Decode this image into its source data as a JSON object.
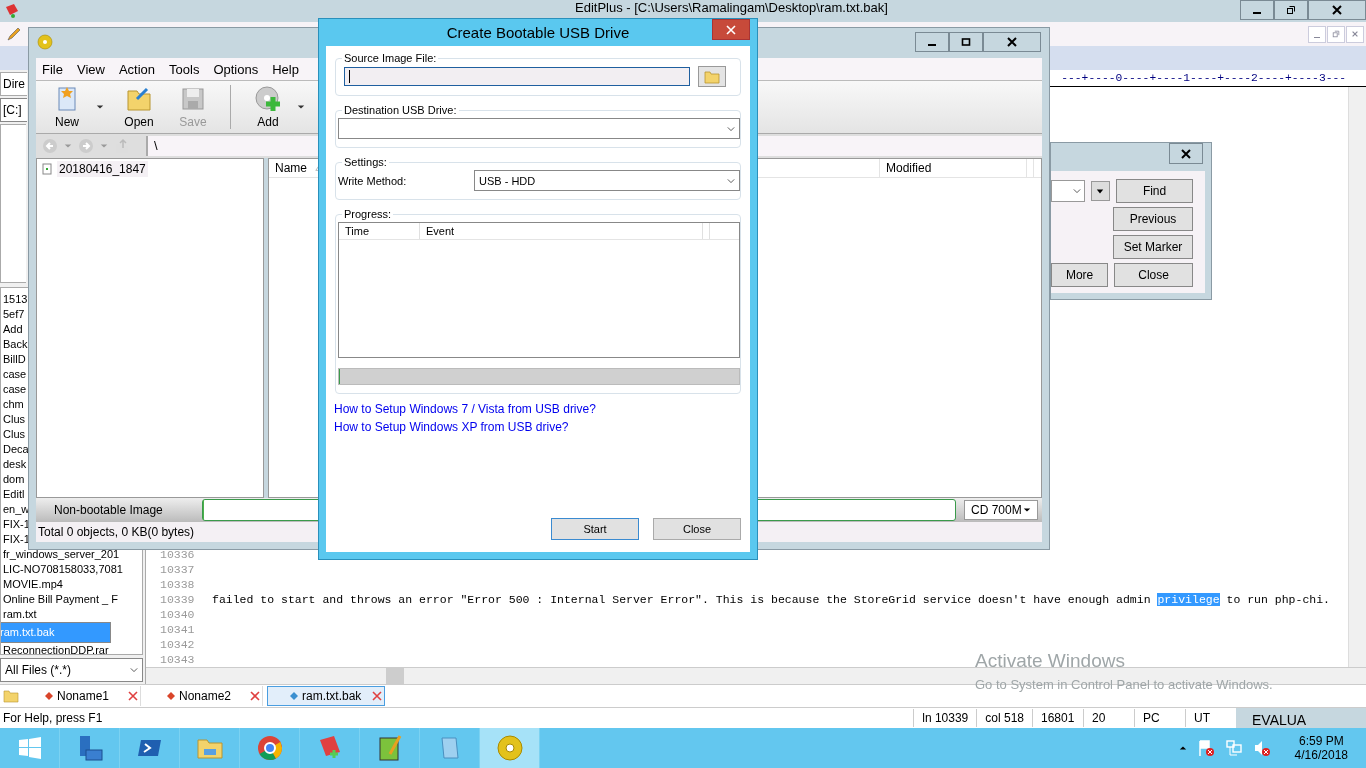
{
  "editplus": {
    "title": "EditPlus - [C:\\Users\\Ramalingam\\Desktop\\ram.txt.bak]",
    "left_panel": {
      "tab": "Dire",
      "drive": "[C:]",
      "files": [
        {
          "name": "1513",
          "selected": false
        },
        {
          "name": "5ef7",
          "selected": false
        },
        {
          "name": "Add",
          "selected": false
        },
        {
          "name": "Back",
          "selected": false
        },
        {
          "name": "BillD",
          "selected": false
        },
        {
          "name": "case",
          "selected": false
        },
        {
          "name": "case",
          "selected": false
        },
        {
          "name": "chm",
          "selected": false
        },
        {
          "name": "Clus",
          "selected": false
        },
        {
          "name": "Clus",
          "selected": false
        },
        {
          "name": "Deca",
          "selected": false
        },
        {
          "name": "desk",
          "selected": false
        },
        {
          "name": "dom",
          "selected": false
        },
        {
          "name": "Editl",
          "selected": false
        },
        {
          "name": "en_w",
          "selected": false
        },
        {
          "name": "FIX-1",
          "selected": false
        },
        {
          "name": "FIX-1",
          "selected": false
        },
        {
          "name": "fr_windows_server_201",
          "selected": false
        },
        {
          "name": "LIC-NO708158033,7081",
          "selected": false
        },
        {
          "name": "MOVIE.mp4",
          "selected": false
        },
        {
          "name": "Online Bill Payment _ F",
          "selected": false
        },
        {
          "name": "ram.txt",
          "selected": false
        },
        {
          "name": "ram.txt.bak",
          "selected": true
        },
        {
          "name": "ReconnectionDDP.rar",
          "selected": false
        }
      ],
      "filter": "All Files (*.*)"
    },
    "ruler": "---+----0----+----1----+----2----+----3---",
    "lines": [
      {
        "number": "10336"
      },
      {
        "number": "10337"
      },
      {
        "number": "10338"
      },
      {
        "number": "10339",
        "segments": [
          {
            "text": "failed to start and throws an error \"Error 500 : Internal Server Error\". This is because the StoreGrid service doesn't have enough admin ",
            "selected": false
          },
          {
            "text": "privilege",
            "selected": true
          },
          {
            "text": " to run php-chi.",
            "selected": false
          }
        ]
      },
      {
        "number": "10340"
      },
      {
        "number": "10341"
      },
      {
        "number": "10342"
      },
      {
        "number": "10343"
      }
    ],
    "doc_tabs": [
      {
        "label": "Noname1",
        "selected": false
      },
      {
        "label": "Noname2",
        "selected": false
      },
      {
        "label": "ram.txt.bak",
        "selected": true
      }
    ],
    "find_dialog": {
      "buttons": [
        "Find",
        "Previous",
        "Set Marker",
        "More",
        "Close"
      ]
    },
    "status_bar": {
      "help": "For Help, press F1",
      "fields": [
        "ln 10339",
        "col 518",
        "16801",
        "20",
        "PC",
        "UT"
      ],
      "edition": "EVALUA"
    }
  },
  "iso_window": {
    "menu": [
      "File",
      "View",
      "Action",
      "Tools",
      "Options",
      "Help"
    ],
    "toolbar": [
      {
        "label": "New",
        "kind": "new",
        "disabled": false,
        "dropdown": true
      },
      {
        "label": "Open",
        "kind": "open",
        "disabled": false,
        "dropdown": false
      },
      {
        "label": "Save",
        "kind": "save",
        "disabled": true,
        "dropdown": false
      },
      {
        "label": "Add",
        "kind": "add",
        "disabled": false,
        "dropdown": true
      }
    ],
    "path": "\\",
    "tree": [
      "20180416_1847"
    ],
    "columns": [
      "Name",
      "Modified"
    ],
    "image_type": "Non-bootable Image",
    "progress": {
      "level": 0
    },
    "capacity": "CD 700M",
    "summary": "Total 0 objects, 0 KB(0 bytes)"
  },
  "usb_dialog": {
    "title": "Create Bootable USB Drive",
    "source_label": "Source Image File:",
    "destination_label": "Destination USB Drive:",
    "settings_label": "Settings:",
    "write_method_label": "Write Method:",
    "write_method": "USB - HDD",
    "progress_label": "Progress:",
    "columns": [
      "Time",
      "Event"
    ],
    "progress": {
      "level": 0
    },
    "links": [
      "How to Setup Windows 7 / Vista from USB drive?",
      "How to Setup Windows XP from USB drive?"
    ],
    "buttons": [
      "Start",
      "Close"
    ]
  },
  "activation": {
    "title": "Activate Windows",
    "message": "Go to System in Control Panel to activate Windows."
  },
  "taskbar": {
    "apps": [
      {
        "kind": "start",
        "selected": false
      },
      {
        "kind": "server",
        "selected": false
      },
      {
        "kind": "powershell",
        "selected": false
      },
      {
        "kind": "explorer",
        "selected": false
      },
      {
        "kind": "chrome",
        "selected": false
      },
      {
        "kind": "notebook",
        "selected": false
      },
      {
        "kind": "editor",
        "selected": false
      },
      {
        "kind": "notepad",
        "selected": false
      },
      {
        "kind": "disc",
        "selected": true
      }
    ],
    "time": "6:59 PM",
    "date": "4/16/2018"
  }
}
